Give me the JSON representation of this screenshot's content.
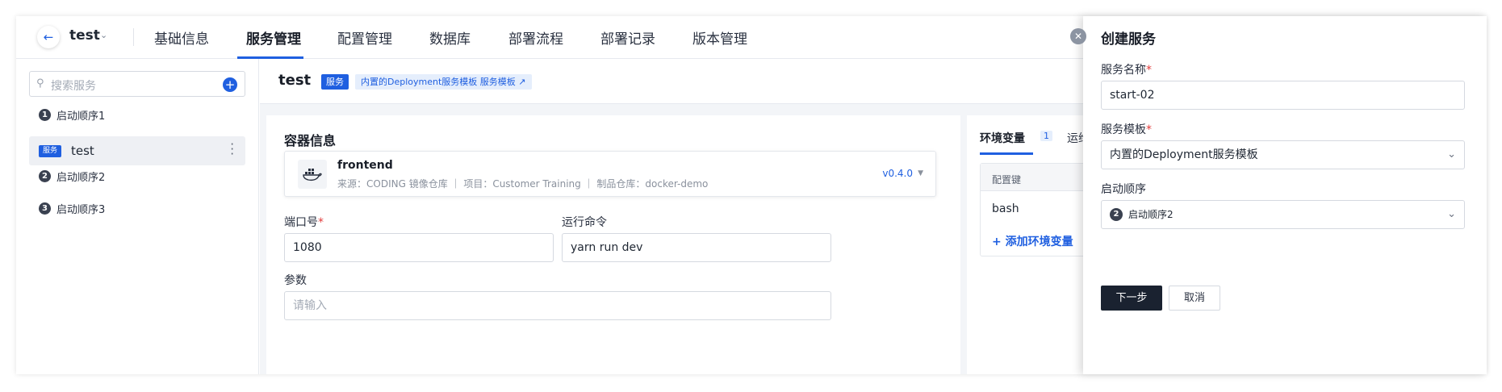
{
  "topnav": {
    "project_name": "test",
    "tabs": [
      {
        "label": "基础信息"
      },
      {
        "label": "服务管理",
        "active": true
      },
      {
        "label": "配置管理"
      },
      {
        "label": "数据库"
      },
      {
        "label": "部署流程"
      },
      {
        "label": "部署记录"
      },
      {
        "label": "版本管理"
      }
    ]
  },
  "sidebar": {
    "search_placeholder": "搜索服务",
    "groups": [
      {
        "num": "1",
        "label": "启动顺序1"
      },
      {
        "num": "2",
        "label": "启动顺序2"
      },
      {
        "num": "3",
        "label": "启动顺序3"
      }
    ],
    "service": {
      "badge": "服务",
      "name": "test"
    }
  },
  "main": {
    "title": "test",
    "badge": "服务",
    "template_link": "内置的Deployment服务模板 服务模板 ↗",
    "section_title": "容器信息",
    "container": {
      "name": "frontend",
      "meta": "来源：CODING 镜像仓库 ｜ 项目：Customer Training ｜ 制品仓库：docker-demo",
      "version": "v0.4.0"
    },
    "port_label": "端口号",
    "port_value": "1080",
    "command_label": "运行命令",
    "command_value": "yarn run dev",
    "params_label": "参数",
    "params_placeholder": "请输入"
  },
  "env": {
    "tab_label": "环境变量",
    "tab_count": "1",
    "tab2_label": "运维",
    "col_key": "配置键",
    "row_key": "bash",
    "add_label": "添加环境变量"
  },
  "drawer": {
    "title": "创建服务",
    "name_label": "服务名称",
    "name_value": "start-02",
    "template_label": "服务模板",
    "template_value": "内置的Deployment服务模板",
    "order_label": "启动顺序",
    "order_num": "2",
    "order_value": "启动顺序2",
    "next_label": "下一步",
    "cancel_label": "取消"
  },
  "colors": {
    "accent": "#1f5fe0",
    "dark_button": "#1a2230",
    "required": "#e23c3c"
  }
}
